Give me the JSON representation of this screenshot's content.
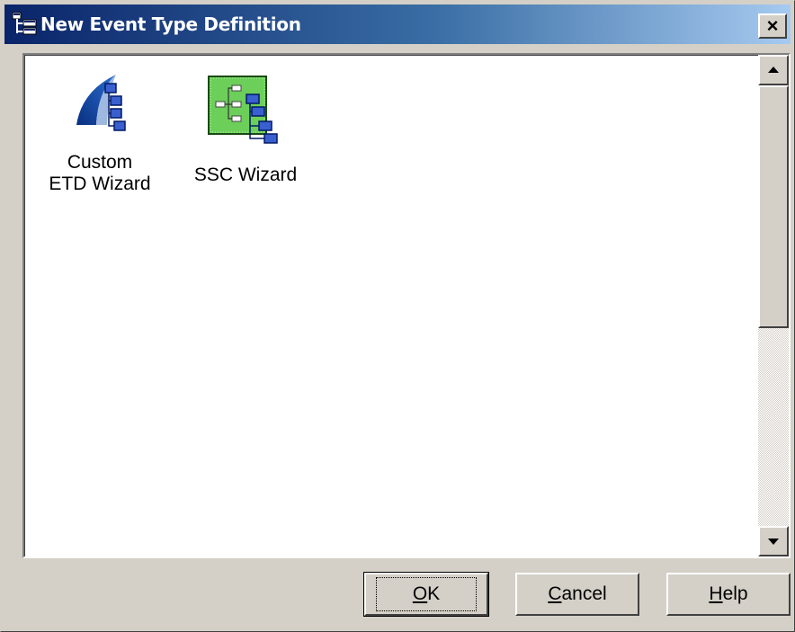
{
  "window": {
    "title": "New Event Type Definition",
    "close_glyph": "×",
    "title_gradient": [
      "#0a246a",
      "#a6caf0"
    ],
    "app_icon": "tree-structure-icon"
  },
  "listview": {
    "items": [
      {
        "label": "Custom ETD Wizard",
        "icon": "custom-etd-wizard-icon"
      },
      {
        "label": "SSC Wizard",
        "icon": "ssc-wizard-icon"
      }
    ]
  },
  "scrollbar": {
    "up_icon": "scroll-up-arrow-icon",
    "down_icon": "scroll-down-arrow-icon"
  },
  "buttons": {
    "ok": {
      "mnemonic": "O",
      "rest": "K"
    },
    "cancel": {
      "mnemonic": "C",
      "rest": "ancel"
    },
    "help": {
      "mnemonic": "H",
      "rest": "elp"
    }
  }
}
